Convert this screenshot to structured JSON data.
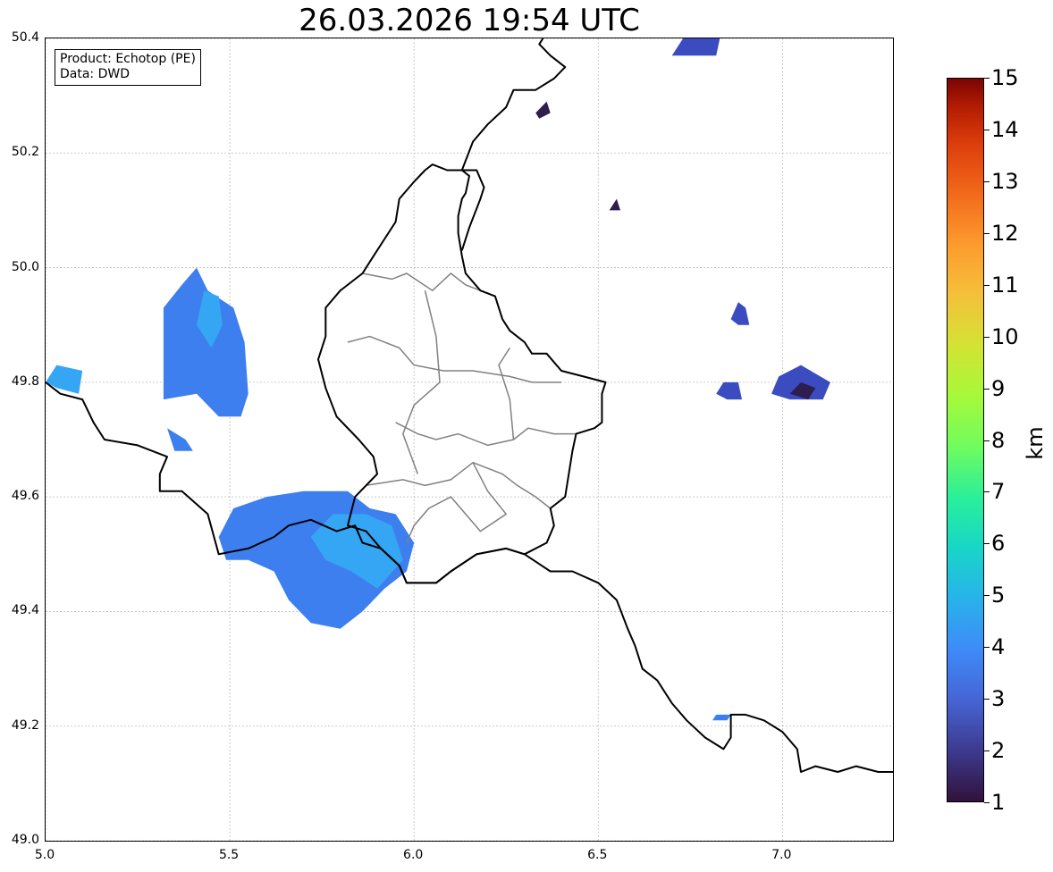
{
  "title": "26.03.2026 19:54 UTC",
  "info_box": {
    "product": "Product: Echotop (PE)",
    "data": "Data: DWD"
  },
  "axes": {
    "x_ticks": [
      "5.0",
      "5.5",
      "6.0",
      "6.5",
      "7.0"
    ],
    "y_ticks": [
      "50.4",
      "50.2",
      "50.0",
      "49.8",
      "49.6",
      "49.4",
      "49.2",
      "49.0"
    ],
    "lon_range": [
      5.0,
      7.3
    ],
    "lat_range": [
      49.0,
      50.4
    ],
    "grid": true
  },
  "colorbar": {
    "unit": "km",
    "labels": [
      "15",
      "14",
      "13",
      "12",
      "11",
      "10",
      "9",
      "8",
      "7",
      "6",
      "5",
      "4",
      "3",
      "2",
      "1"
    ],
    "range": [
      1,
      15
    ]
  },
  "colors": {
    "low_dark": "#2d1e4f",
    "level_2": "#3a4cc0",
    "level_3": "#3d7fef",
    "level_4": "#35a6f3",
    "border": "#000000",
    "districts": "#808080",
    "grid": "#bbbbbb"
  },
  "precip_cells": [
    {
      "name": "cell-west-large",
      "level": 3,
      "points": [
        [
          5.32,
          49.77
        ],
        [
          5.32,
          49.93
        ],
        [
          5.37,
          49.97
        ],
        [
          5.41,
          50.0
        ],
        [
          5.44,
          49.96
        ],
        [
          5.51,
          49.93
        ],
        [
          5.54,
          49.87
        ],
        [
          5.55,
          49.78
        ],
        [
          5.53,
          49.74
        ],
        [
          5.47,
          49.74
        ],
        [
          5.41,
          49.78
        ]
      ]
    },
    {
      "name": "cell-west-core",
      "level": 4,
      "points": [
        [
          5.41,
          49.9
        ],
        [
          5.43,
          49.96
        ],
        [
          5.47,
          49.95
        ],
        [
          5.48,
          49.9
        ],
        [
          5.45,
          49.86
        ]
      ]
    },
    {
      "name": "cell-edge-west",
      "level": 4,
      "points": [
        [
          5.0,
          49.8
        ],
        [
          5.03,
          49.83
        ],
        [
          5.1,
          49.82
        ],
        [
          5.09,
          49.78
        ],
        [
          5.03,
          49.79
        ]
      ]
    },
    {
      "name": "cell-small-sw",
      "level": 3,
      "points": [
        [
          5.33,
          49.72
        ],
        [
          5.38,
          49.7
        ],
        [
          5.4,
          49.68
        ],
        [
          5.35,
          49.68
        ]
      ]
    },
    {
      "name": "cell-south",
      "level": 3,
      "points": [
        [
          5.47,
          49.53
        ],
        [
          5.51,
          49.58
        ],
        [
          5.6,
          49.6
        ],
        [
          5.7,
          49.61
        ],
        [
          5.82,
          49.61
        ],
        [
          5.88,
          49.58
        ],
        [
          5.95,
          49.57
        ],
        [
          6.0,
          49.52
        ],
        [
          5.98,
          49.47
        ],
        [
          5.92,
          49.44
        ],
        [
          5.86,
          49.4
        ],
        [
          5.8,
          49.37
        ],
        [
          5.72,
          49.38
        ],
        [
          5.66,
          49.42
        ],
        [
          5.62,
          49.47
        ],
        [
          5.55,
          49.49
        ],
        [
          5.49,
          49.49
        ]
      ]
    },
    {
      "name": "cell-south-core",
      "level": 4,
      "points": [
        [
          5.72,
          49.53
        ],
        [
          5.78,
          49.57
        ],
        [
          5.87,
          49.57
        ],
        [
          5.94,
          49.55
        ],
        [
          5.97,
          49.49
        ],
        [
          5.9,
          49.44
        ],
        [
          5.83,
          49.47
        ],
        [
          5.76,
          49.49
        ]
      ]
    },
    {
      "name": "cell-north-top",
      "level": 2,
      "points": [
        [
          6.7,
          50.37
        ],
        [
          6.73,
          50.4
        ],
        [
          6.83,
          50.4
        ],
        [
          6.82,
          50.37
        ],
        [
          6.77,
          50.37
        ]
      ]
    },
    {
      "name": "cell-north-small-a",
      "level": 1,
      "points": [
        [
          6.33,
          50.27
        ],
        [
          6.36,
          50.29
        ],
        [
          6.37,
          50.27
        ],
        [
          6.34,
          50.26
        ]
      ]
    },
    {
      "name": "cell-north-small-b",
      "level": 1,
      "points": [
        [
          6.53,
          50.1
        ],
        [
          6.55,
          50.12
        ],
        [
          6.56,
          50.1
        ]
      ]
    },
    {
      "name": "cell-east-a",
      "level": 2,
      "points": [
        [
          6.86,
          49.91
        ],
        [
          6.88,
          49.94
        ],
        [
          6.9,
          49.93
        ],
        [
          6.91,
          49.9
        ],
        [
          6.88,
          49.9
        ]
      ]
    },
    {
      "name": "cell-east-b",
      "level": 2,
      "points": [
        [
          6.82,
          49.78
        ],
        [
          6.84,
          49.8
        ],
        [
          6.88,
          49.8
        ],
        [
          6.89,
          49.77
        ],
        [
          6.85,
          49.77
        ]
      ]
    },
    {
      "name": "cell-east-c",
      "level": 2,
      "points": [
        [
          6.97,
          49.78
        ],
        [
          6.99,
          49.81
        ],
        [
          7.05,
          49.83
        ],
        [
          7.13,
          49.8
        ],
        [
          7.11,
          49.77
        ],
        [
          7.02,
          49.77
        ]
      ]
    },
    {
      "name": "cell-east-c-core",
      "level": 1,
      "points": [
        [
          7.02,
          49.78
        ],
        [
          7.05,
          49.8
        ],
        [
          7.09,
          49.79
        ],
        [
          7.07,
          49.77
        ]
      ]
    },
    {
      "name": "cell-south-east-small",
      "level": 3,
      "points": [
        [
          6.81,
          49.21
        ],
        [
          6.82,
          49.22
        ],
        [
          6.86,
          49.22
        ],
        [
          6.85,
          49.21
        ]
      ]
    }
  ],
  "national_border": [
    [
      5.0,
      49.8
    ],
    [
      5.04,
      49.78
    ],
    [
      5.1,
      49.77
    ],
    [
      5.13,
      49.73
    ],
    [
      5.16,
      49.7
    ],
    [
      5.25,
      49.69
    ],
    [
      5.33,
      49.67
    ],
    [
      5.31,
      49.64
    ],
    [
      5.31,
      49.61
    ],
    [
      5.37,
      49.61
    ],
    [
      5.44,
      49.57
    ],
    [
      5.47,
      49.5
    ],
    [
      5.55,
      49.51
    ],
    [
      5.62,
      49.53
    ],
    [
      5.66,
      49.55
    ],
    [
      5.72,
      49.56
    ],
    [
      5.79,
      49.54
    ],
    [
      5.84,
      49.55
    ],
    [
      5.86,
      49.52
    ],
    [
      5.91,
      49.51
    ],
    [
      5.96,
      49.48
    ],
    [
      5.98,
      49.45
    ],
    [
      6.06,
      49.45
    ],
    [
      6.1,
      49.47
    ],
    [
      6.17,
      49.5
    ],
    [
      6.25,
      49.51
    ],
    [
      6.3,
      49.5
    ],
    [
      6.37,
      49.47
    ],
    [
      6.43,
      49.47
    ],
    [
      6.5,
      49.45
    ],
    [
      6.55,
      49.42
    ],
    [
      6.58,
      49.37
    ],
    [
      6.6,
      49.34
    ],
    [
      6.62,
      49.3
    ],
    [
      6.66,
      49.28
    ],
    [
      6.7,
      49.24
    ],
    [
      6.74,
      49.21
    ],
    [
      6.79,
      49.18
    ],
    [
      6.84,
      49.16
    ],
    [
      6.86,
      49.18
    ],
    [
      6.86,
      49.22
    ],
    [
      6.9,
      49.22
    ],
    [
      6.95,
      49.21
    ],
    [
      7.0,
      49.19
    ],
    [
      7.04,
      49.16
    ],
    [
      7.05,
      49.12
    ],
    [
      7.09,
      49.13
    ],
    [
      7.15,
      49.12
    ],
    [
      7.2,
      49.13
    ],
    [
      7.26,
      49.12
    ],
    [
      7.3,
      49.12
    ]
  ],
  "lux_border": [
    [
      6.13,
      50.17
    ],
    [
      6.15,
      50.16
    ],
    [
      6.14,
      50.13
    ],
    [
      6.13,
      50.12
    ],
    [
      6.12,
      50.09
    ],
    [
      6.12,
      50.06
    ],
    [
      6.13,
      50.02
    ],
    [
      6.14,
      49.99
    ],
    [
      6.18,
      49.96
    ],
    [
      6.22,
      49.95
    ],
    [
      6.24,
      49.91
    ],
    [
      6.26,
      49.89
    ],
    [
      6.3,
      49.87
    ],
    [
      6.32,
      49.85
    ],
    [
      6.36,
      49.85
    ],
    [
      6.4,
      49.82
    ],
    [
      6.46,
      49.81
    ],
    [
      6.52,
      49.8
    ],
    [
      6.51,
      49.78
    ],
    [
      6.51,
      49.73
    ],
    [
      6.49,
      49.72
    ],
    [
      6.44,
      49.71
    ],
    [
      6.43,
      49.68
    ],
    [
      6.42,
      49.64
    ],
    [
      6.41,
      49.6
    ],
    [
      6.37,
      49.58
    ],
    [
      6.38,
      49.55
    ],
    [
      6.36,
      49.52
    ],
    [
      6.3,
      49.5
    ],
    [
      6.25,
      49.51
    ],
    [
      6.17,
      49.5
    ],
    [
      6.1,
      49.47
    ],
    [
      6.06,
      49.45
    ],
    [
      6.0,
      49.45
    ],
    [
      5.98,
      49.45
    ],
    [
      5.96,
      49.48
    ],
    [
      5.91,
      49.51
    ],
    [
      5.87,
      49.54
    ],
    [
      5.82,
      49.55
    ],
    [
      5.84,
      49.6
    ],
    [
      5.87,
      49.62
    ],
    [
      5.9,
      49.64
    ],
    [
      5.89,
      49.67
    ],
    [
      5.85,
      49.7
    ],
    [
      5.79,
      49.74
    ],
    [
      5.76,
      49.79
    ],
    [
      5.74,
      49.84
    ],
    [
      5.76,
      49.88
    ],
    [
      5.76,
      49.93
    ],
    [
      5.8,
      49.96
    ],
    [
      5.86,
      49.99
    ],
    [
      5.89,
      50.02
    ],
    [
      5.92,
      50.05
    ],
    [
      5.95,
      50.08
    ],
    [
      5.96,
      50.12
    ],
    [
      6.0,
      50.15
    ],
    [
      6.03,
      50.17
    ],
    [
      6.05,
      50.18
    ],
    [
      6.09,
      50.17
    ],
    [
      6.13,
      50.17
    ]
  ],
  "de_border": [
    [
      6.13,
      50.17
    ],
    [
      6.17,
      50.17
    ],
    [
      6.19,
      50.14
    ],
    [
      6.18,
      50.12
    ],
    [
      6.15,
      50.07
    ],
    [
      6.13,
      50.03
    ]
  ],
  "be_border": [
    [
      6.13,
      50.17
    ],
    [
      6.16,
      50.22
    ],
    [
      6.2,
      50.25
    ],
    [
      6.25,
      50.28
    ],
    [
      6.27,
      50.31
    ],
    [
      6.33,
      50.31
    ],
    [
      6.38,
      50.33
    ],
    [
      6.41,
      50.35
    ],
    [
      6.37,
      50.37
    ],
    [
      6.34,
      50.39
    ],
    [
      6.35,
      50.4
    ]
  ],
  "districts": [
    [
      [
        5.87,
        49.62
      ],
      [
        5.97,
        49.63
      ],
      [
        6.03,
        49.62
      ],
      [
        6.1,
        49.63
      ],
      [
        6.16,
        49.66
      ],
      [
        6.24,
        49.64
      ],
      [
        6.28,
        49.62
      ],
      [
        6.33,
        49.6
      ],
      [
        6.37,
        49.58
      ]
    ],
    [
      [
        5.95,
        49.73
      ],
      [
        6.01,
        49.71
      ],
      [
        6.06,
        49.7
      ],
      [
        6.12,
        49.71
      ],
      [
        6.2,
        49.69
      ],
      [
        6.27,
        49.7
      ],
      [
        6.31,
        49.72
      ],
      [
        6.38,
        49.71
      ],
      [
        6.44,
        49.71
      ]
    ],
    [
      [
        5.82,
        49.87
      ],
      [
        5.88,
        49.88
      ],
      [
        5.96,
        49.86
      ],
      [
        6.0,
        49.83
      ],
      [
        6.08,
        49.82
      ],
      [
        6.16,
        49.82
      ],
      [
        6.26,
        49.81
      ],
      [
        6.32,
        49.8
      ],
      [
        6.4,
        49.8
      ]
    ],
    [
      [
        5.86,
        49.99
      ],
      [
        5.94,
        49.98
      ],
      [
        5.98,
        49.99
      ],
      [
        6.05,
        49.96
      ],
      [
        6.1,
        49.99
      ],
      [
        6.14,
        49.97
      ],
      [
        6.18,
        49.96
      ]
    ],
    [
      [
        6.03,
        49.96
      ],
      [
        6.06,
        49.88
      ],
      [
        6.07,
        49.8
      ],
      [
        6.0,
        49.76
      ],
      [
        5.97,
        49.71
      ],
      [
        6.01,
        49.64
      ]
    ],
    [
      [
        6.16,
        49.66
      ],
      [
        6.2,
        49.61
      ],
      [
        6.25,
        49.57
      ],
      [
        6.18,
        49.54
      ],
      [
        6.14,
        49.57
      ],
      [
        6.1,
        49.6
      ],
      [
        6.04,
        49.58
      ],
      [
        6.0,
        49.55
      ],
      [
        5.98,
        49.52
      ]
    ],
    [
      [
        6.27,
        49.7
      ],
      [
        6.26,
        49.77
      ],
      [
        6.23,
        49.83
      ],
      [
        6.26,
        49.86
      ]
    ]
  ]
}
